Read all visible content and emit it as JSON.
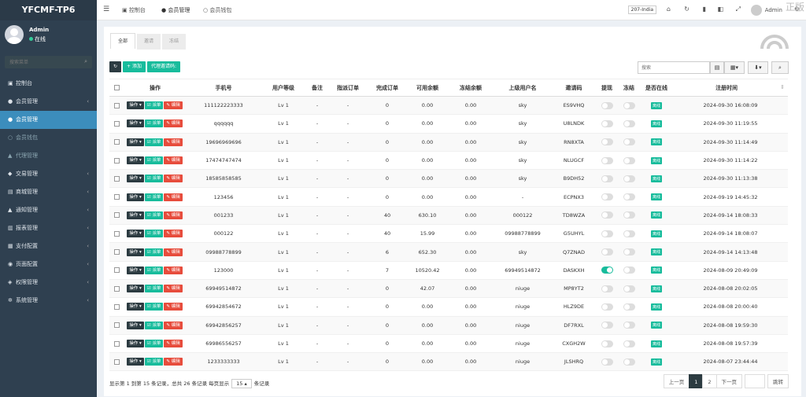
{
  "sidebar": {
    "brand": "YFCMF-TP6",
    "user_name": "Admin",
    "user_status": "在线",
    "search_placeholder": "搜索菜单",
    "items": [
      {
        "label": "控制台",
        "icon": "dashboard-icon",
        "glyph": "▣",
        "state": "normal",
        "has_arrow": false
      },
      {
        "label": "会员管理",
        "icon": "user-group-icon",
        "glyph": "●",
        "state": "normal",
        "has_arrow": true
      },
      {
        "label": "会员管理",
        "icon": "user-icon",
        "glyph": "●",
        "state": "active",
        "has_arrow": false
      },
      {
        "label": "会员钱包",
        "icon": "wallet-icon",
        "glyph": "○",
        "state": "sub",
        "has_arrow": false
      },
      {
        "label": "代理管理",
        "icon": "sitemap-icon",
        "glyph": "▲",
        "state": "sub",
        "has_arrow": false
      },
      {
        "label": "交易管理",
        "icon": "trade-icon",
        "glyph": "◆",
        "state": "normal",
        "has_arrow": true
      },
      {
        "label": "商城管理",
        "icon": "shop-icon",
        "glyph": "▤",
        "state": "normal",
        "has_arrow": true
      },
      {
        "label": "通知管理",
        "icon": "bell-icon",
        "glyph": "▲",
        "state": "normal",
        "has_arrow": true
      },
      {
        "label": "报表管理",
        "icon": "chart-icon",
        "glyph": "▥",
        "state": "normal",
        "has_arrow": true
      },
      {
        "label": "支付配置",
        "icon": "payment-icon",
        "glyph": "▦",
        "state": "normal",
        "has_arrow": true
      },
      {
        "label": "页面配置",
        "icon": "page-icon",
        "glyph": "◉",
        "state": "normal",
        "has_arrow": true
      },
      {
        "label": "权限管理",
        "icon": "permission-icon",
        "glyph": "◈",
        "state": "normal",
        "has_arrow": true
      },
      {
        "label": "系统管理",
        "icon": "cogs-icon",
        "glyph": "✲",
        "state": "normal",
        "has_arrow": true
      }
    ]
  },
  "topbar": {
    "tabs": [
      {
        "label": "控制台",
        "icon": "dashboard-icon"
      },
      {
        "label": "会员管理",
        "icon": "user-icon"
      },
      {
        "label": "会员钱包",
        "icon": "wallet-icon"
      }
    ],
    "language": "207-India",
    "admin": "Admin",
    "watermark": "正版"
  },
  "content": {
    "tabs": [
      "全部",
      "邀请",
      "冻结"
    ],
    "toolbar": {
      "refresh_icon": "refresh-icon",
      "add_label": "+ 添加",
      "invite_label": "代理邀请码:"
    },
    "search_placeholder": "搜索",
    "columns": [
      "",
      "操作",
      "手机号",
      "用户等级",
      "备注",
      "指派订单",
      "完成订单",
      "可用余额",
      "冻结余额",
      "上级用户名",
      "邀请码",
      "提现",
      "冻结",
      "是否在线",
      "注册时间"
    ],
    "action_labels": {
      "op": "操作",
      "choose": "派单",
      "edit": "编辑"
    },
    "online_label": "离线",
    "rows": [
      {
        "phone": "111122223333",
        "level": "Lv 1",
        "remark": "-",
        "assigned": "-",
        "completed": "0",
        "available": "0.00",
        "frozen": "0.00",
        "parent": "sky",
        "code": "ES9VHQ",
        "withdraw": false,
        "freeze": false,
        "time": "2024-09-30 16:08:09"
      },
      {
        "phone": "qqqqqq",
        "level": "Lv 1",
        "remark": "-",
        "assigned": "-",
        "completed": "0",
        "available": "0.00",
        "frozen": "0.00",
        "parent": "sky",
        "code": "U8LNDK",
        "withdraw": false,
        "freeze": false,
        "time": "2024-09-30 11:19:55"
      },
      {
        "phone": "19696969696",
        "level": "Lv 1",
        "remark": "-",
        "assigned": "-",
        "completed": "0",
        "available": "0.00",
        "frozen": "0.00",
        "parent": "sky",
        "code": "RN8XTA",
        "withdraw": false,
        "freeze": false,
        "time": "2024-09-30 11:14:49"
      },
      {
        "phone": "17474747474",
        "level": "Lv 1",
        "remark": "-",
        "assigned": "-",
        "completed": "0",
        "available": "0.00",
        "frozen": "0.00",
        "parent": "sky",
        "code": "NLUGCF",
        "withdraw": false,
        "freeze": false,
        "time": "2024-09-30 11:14:22"
      },
      {
        "phone": "18585858585",
        "level": "Lv 1",
        "remark": "-",
        "assigned": "-",
        "completed": "0",
        "available": "0.00",
        "frozen": "0.00",
        "parent": "sky",
        "code": "B9DH52",
        "withdraw": false,
        "freeze": false,
        "time": "2024-09-30 11:13:38"
      },
      {
        "phone": "123456",
        "level": "Lv 1",
        "remark": "-",
        "assigned": "-",
        "completed": "0",
        "available": "0.00",
        "frozen": "0.00",
        "parent": "-",
        "code": "ECPNX3",
        "withdraw": false,
        "freeze": false,
        "time": "2024-09-19 14:45:32"
      },
      {
        "phone": "001233",
        "level": "Lv 1",
        "remark": "-",
        "assigned": "-",
        "completed": "40",
        "available": "630.10",
        "frozen": "0.00",
        "parent": "000122",
        "code": "TD8WZA",
        "withdraw": false,
        "freeze": false,
        "time": "2024-09-14 18:08:33"
      },
      {
        "phone": "000122",
        "level": "Lv 1",
        "remark": "-",
        "assigned": "-",
        "completed": "40",
        "available": "15.99",
        "frozen": "0.00",
        "parent": "09988778899",
        "code": "G5UHYL",
        "withdraw": false,
        "freeze": false,
        "time": "2024-09-14 18:08:07"
      },
      {
        "phone": "09988778899",
        "level": "Lv 1",
        "remark": "-",
        "assigned": "-",
        "completed": "6",
        "available": "652.30",
        "frozen": "0.00",
        "parent": "sky",
        "code": "Q7ZNAD",
        "withdraw": false,
        "freeze": false,
        "time": "2024-09-14 14:13:48"
      },
      {
        "phone": "123000",
        "level": "Lv 1",
        "remark": "-",
        "assigned": "-",
        "completed": "7",
        "available": "10520.42",
        "frozen": "0.00",
        "parent": "69949514872",
        "code": "DASKXH",
        "withdraw": true,
        "freeze": false,
        "time": "2024-08-09 20:49:09"
      },
      {
        "phone": "69949514872",
        "level": "Lv 1",
        "remark": "-",
        "assigned": "-",
        "completed": "0",
        "available": "42.07",
        "frozen": "0.00",
        "parent": "niuge",
        "code": "MP8YT2",
        "withdraw": false,
        "freeze": false,
        "time": "2024-08-08 20:02:05"
      },
      {
        "phone": "69942854672",
        "level": "Lv 1",
        "remark": "-",
        "assigned": "-",
        "completed": "0",
        "available": "0.00",
        "frozen": "0.00",
        "parent": "niuge",
        "code": "HLZ9DE",
        "withdraw": false,
        "freeze": false,
        "time": "2024-08-08 20:00:40"
      },
      {
        "phone": "69942856257",
        "level": "Lv 1",
        "remark": "-",
        "assigned": "-",
        "completed": "0",
        "available": "0.00",
        "frozen": "0.00",
        "parent": "niuge",
        "code": "DF7RXL",
        "withdraw": false,
        "freeze": false,
        "time": "2024-08-08 19:59:30"
      },
      {
        "phone": "69986556257",
        "level": "Lv 1",
        "remark": "-",
        "assigned": "-",
        "completed": "0",
        "available": "0.00",
        "frozen": "0.00",
        "parent": "niuge",
        "code": "CXGH2W",
        "withdraw": false,
        "freeze": false,
        "time": "2024-08-08 19:57:39"
      },
      {
        "phone": "1233333333",
        "level": "Lv 1",
        "remark": "-",
        "assigned": "-",
        "completed": "0",
        "available": "0.00",
        "frozen": "0.00",
        "parent": "niuge",
        "code": "JLSHRQ",
        "withdraw": false,
        "freeze": false,
        "time": "2024-08-07 23:44:44"
      }
    ],
    "footer": {
      "info_prefix": "显示第 1 到第 15 条记录，总共 26 条记录 每页显示",
      "page_size": "15",
      "info_suffix": "条记录"
    },
    "pagination": {
      "prev": "上一页",
      "pages": [
        "1",
        "2"
      ],
      "current": "1",
      "next": "下一页",
      "go": "跳转"
    }
  }
}
